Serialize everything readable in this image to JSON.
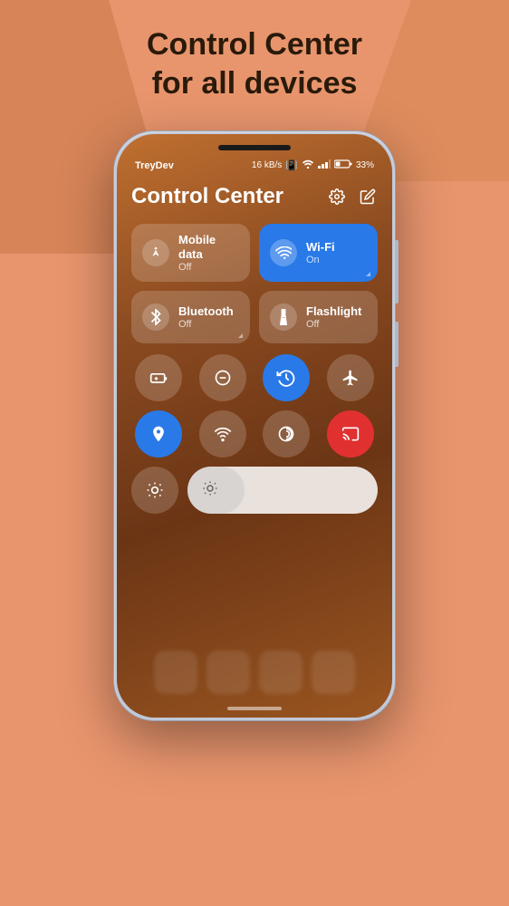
{
  "page": {
    "background_color": "#E8956D",
    "header": {
      "line1": "Control Center",
      "line2": "for all devices"
    }
  },
  "phone": {
    "status_bar": {
      "carrier": "TreyDev",
      "speed": "16 kB/s",
      "battery": "33%"
    },
    "control_center": {
      "title": "Control Center",
      "tiles": [
        {
          "id": "mobile-data",
          "label": "Mobile data",
          "status": "Off",
          "active": false
        },
        {
          "id": "wifi",
          "label": "Wi-Fi",
          "status": "On",
          "active": true
        },
        {
          "id": "bluetooth",
          "label": "Bluetooth",
          "status": "Off",
          "active": false
        },
        {
          "id": "flashlight",
          "label": "Flashlight",
          "status": "Off",
          "active": false
        }
      ],
      "round_row1": [
        {
          "id": "battery",
          "icon": "battery",
          "active": false
        },
        {
          "id": "dnd",
          "icon": "minus-circle",
          "active": false
        },
        {
          "id": "rotate",
          "icon": "rotate",
          "active": true
        },
        {
          "id": "airplane",
          "icon": "airplane",
          "active": false
        }
      ],
      "round_row2": [
        {
          "id": "location",
          "icon": "location",
          "active": true
        },
        {
          "id": "hotspot",
          "icon": "hotspot",
          "active": false
        },
        {
          "id": "nfc",
          "icon": "nfc",
          "active": false
        },
        {
          "id": "cast",
          "icon": "cast",
          "active": true,
          "color": "red"
        }
      ],
      "brightness": {
        "label": "Brightness",
        "value": 30
      }
    }
  }
}
